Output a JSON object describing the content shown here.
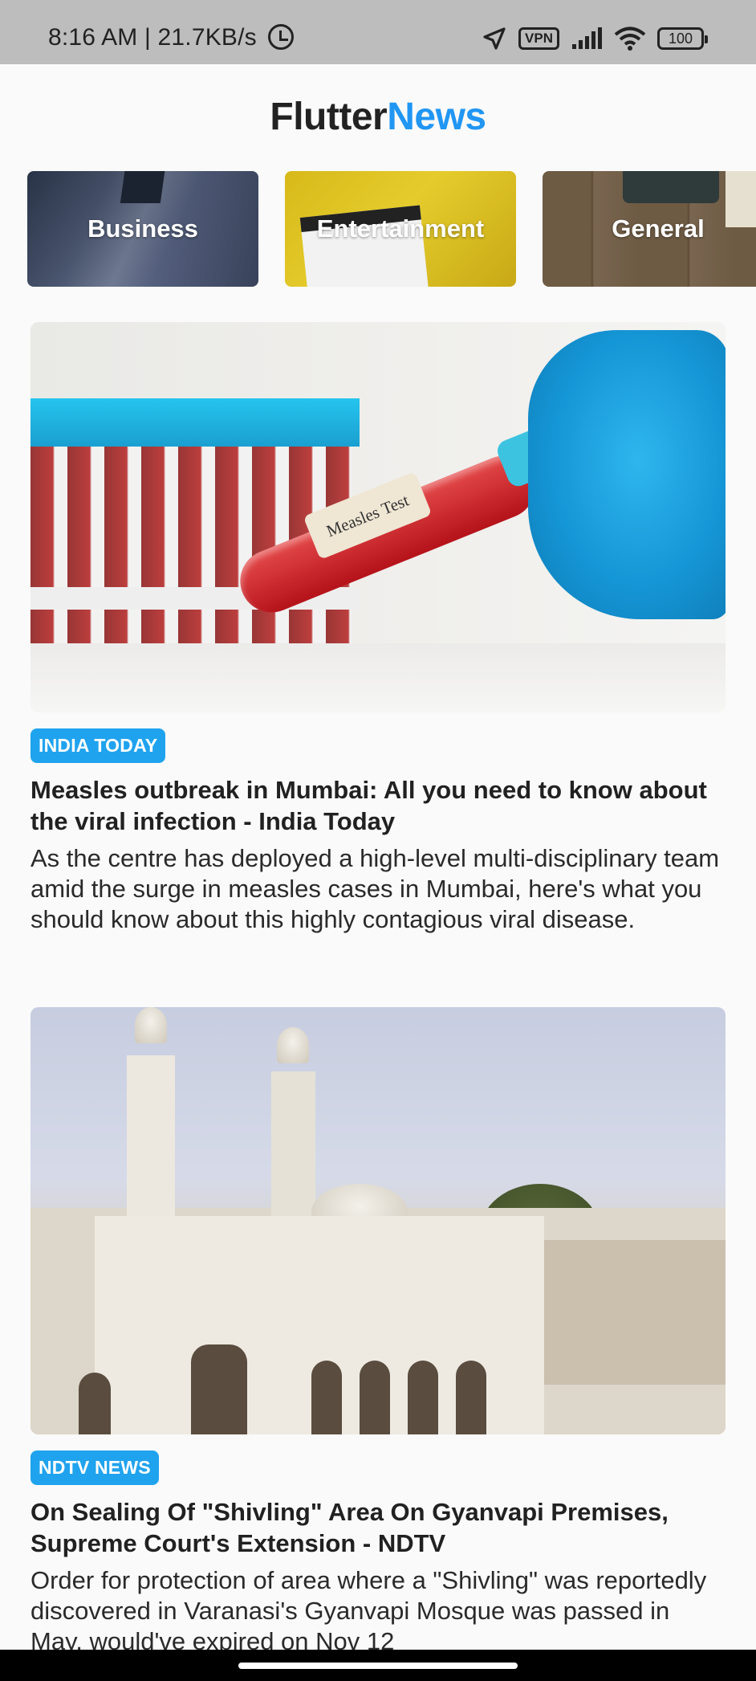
{
  "status_bar": {
    "time_speed": "8:16 AM | 21.7KB/s",
    "vpn": "VPN",
    "battery": "100"
  },
  "app_title": {
    "part1": "Flutter",
    "part2": "News"
  },
  "colors": {
    "accent": "#2196f3",
    "badge": "#20a3ee",
    "status_bar": "#bdbdbd"
  },
  "categories": [
    {
      "label": "Business"
    },
    {
      "label": "Entertainment"
    },
    {
      "label": "General"
    }
  ],
  "articles": [
    {
      "image_label": "Measles Test",
      "source": "INDIA TODAY",
      "title": "Measles outbreak in Mumbai: All you need to know about the viral infection - India Today",
      "description": "As the centre has deployed a high-level multi-disciplinary team amid the surge in measles cases in Mumbai, here's what you should know about this highly contagious viral disease."
    },
    {
      "source": "NDTV NEWS",
      "title": "On Sealing Of \"Shivling\" Area On Gyanvapi Premises, Supreme Court's Extension - NDTV",
      "description": "Order for protection of area where a \"Shivling\" was reportedly discovered in Varanasi's Gyanvapi Mosque was passed in May, would've expired on Nov 12"
    }
  ],
  "icons": [
    "alarm-icon",
    "location-arrow-icon",
    "vpn-icon",
    "signal-icon",
    "wifi-icon",
    "battery-icon"
  ]
}
